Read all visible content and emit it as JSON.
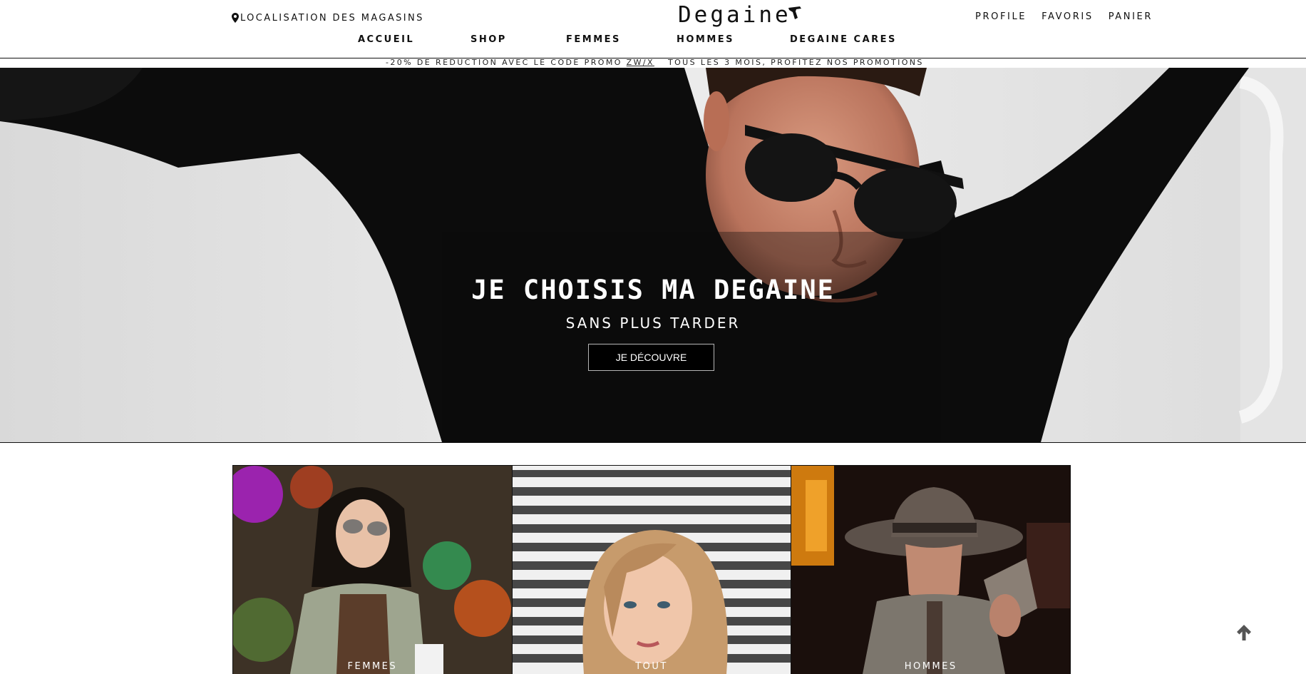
{
  "header": {
    "store_locator": "LOCALISATION DES MAGASINS",
    "logo": "Degaine",
    "user_nav": [
      "PROFILE",
      "FAVORIS",
      "PANIER"
    ],
    "main_nav": [
      "ACCUEIL",
      "SHOP",
      "FEMMES",
      "HOMMES",
      "DEGAINE CARES"
    ]
  },
  "promo": {
    "left_prefix": "-20% DE REDUCTION AVEC LE CODE PROMO ",
    "code": "ZW/X",
    "right": "TOUS LES 3 MOIS, PROFITEZ NOS PROMOTIONS"
  },
  "hero": {
    "title": "JE CHOISIS MA DEGAINE",
    "subtitle": "SANS PLUS TARDER",
    "cta": "JE DÉCOUVRE"
  },
  "categories": [
    {
      "label": "FEMMES"
    },
    {
      "label": "TOUT"
    },
    {
      "label": "HOMMES"
    }
  ],
  "icons": {
    "store_locator": "map-pin-icon",
    "scroll_top": "arrow-up-icon"
  },
  "colors": {
    "text": "#111111",
    "background": "#ffffff",
    "button_bg": "#000000"
  }
}
